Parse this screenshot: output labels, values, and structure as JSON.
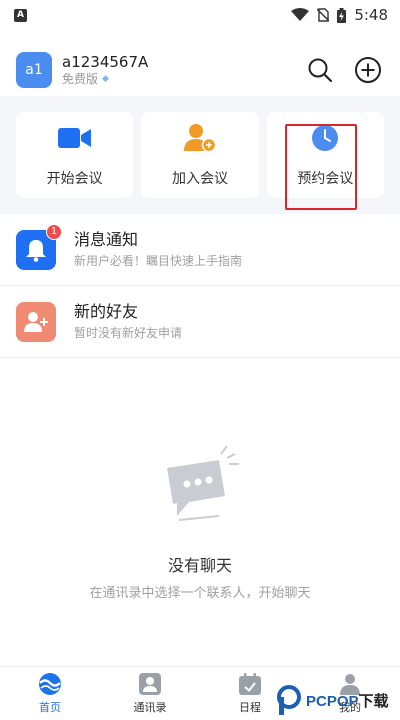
{
  "status_bar": {
    "app_badge": "A",
    "time": "5:48"
  },
  "header": {
    "avatar_text": "a1",
    "username": "a1234567A",
    "edition": "免费版"
  },
  "actions": [
    {
      "label": "开始会议",
      "icon": "video-camera-icon",
      "color": "#1e6ff1"
    },
    {
      "label": "加入会议",
      "icon": "add-person-icon",
      "color": "#f29a26"
    },
    {
      "label": "预约会议",
      "icon": "clock-icon",
      "color": "#4a8cf0"
    }
  ],
  "list": [
    {
      "title": "消息通知",
      "subtitle": "新用户必看！瞩目快速上手指南",
      "badge": "1",
      "icon": "bell-icon",
      "color": "#1e6ff1"
    },
    {
      "title": "新的好友",
      "subtitle": "暂时没有新好友申请",
      "icon": "add-friend-icon",
      "color": "#f08a72"
    }
  ],
  "empty_state": {
    "title": "没有聊天",
    "subtitle": "在通讯录中选择一个联系人，开始聊天"
  },
  "bottom_nav": [
    {
      "label": "首页",
      "icon": "home-logo-icon",
      "active": true
    },
    {
      "label": "通讯录",
      "icon": "contacts-icon"
    },
    {
      "label": "日程",
      "icon": "calendar-icon"
    },
    {
      "label": "我的",
      "icon": "profile-icon"
    }
  ],
  "watermark": {
    "brand": "PCPOP",
    "suffix": "下载"
  },
  "colors": {
    "accent": "#1a73e8",
    "highlight_border": "#d9252b"
  }
}
